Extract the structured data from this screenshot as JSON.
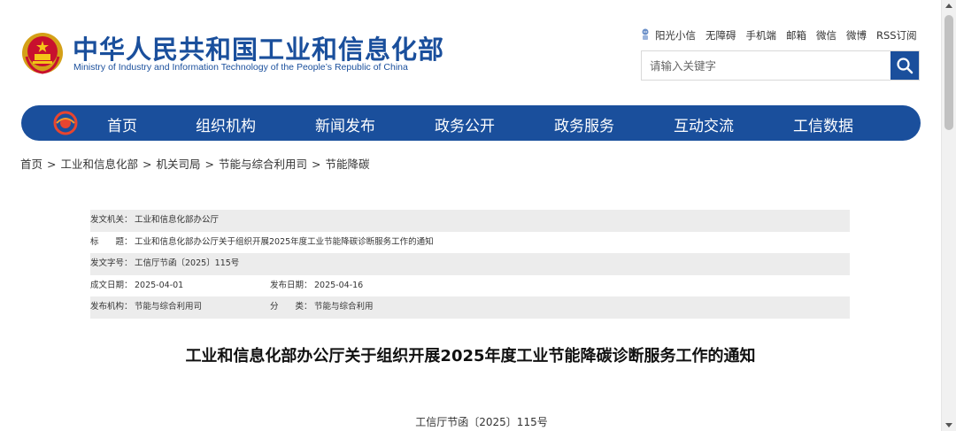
{
  "header": {
    "title": "中华人民共和国工业和信息化部",
    "subtitle": "Ministry of Industry and Information Technology of the People’s Republic of China",
    "toplinks": [
      "阳光小信",
      "无障碍",
      "手机端",
      "邮箱",
      "微信",
      "微博",
      "RSS订阅"
    ],
    "search_placeholder": "请输入关键字"
  },
  "nav": {
    "items": [
      "首页",
      "组织机构",
      "新闻发布",
      "政务公开",
      "政务服务",
      "互动交流",
      "工信数据"
    ]
  },
  "breadcrumb": [
    "首页",
    "工业和信息化部",
    "机关司局",
    "节能与综合利用司",
    "节能降碳"
  ],
  "meta": {
    "issuer_label": "发文机关：",
    "issuer": "工业和信息化部办公厅",
    "title_label": "标　　题：",
    "title": "工业和信息化部办公厅关于组织开展2025年度工业节能降碳诊断服务工作的通知",
    "docno_label": "发文字号：",
    "docno": "工信厅节函〔2025〕115号",
    "created_label": "成文日期：",
    "created": "2025-04-01",
    "published_label": "发布日期：",
    "published": "2025-04-16",
    "agency_label": "发布机构：",
    "agency": "节能与综合利用司",
    "category_label": "分　　类：",
    "category": "节能与综合利用"
  },
  "document": {
    "title": "工业和信息化部办公厅关于组织开展2025年度工业节能降碳诊断服务工作的通知",
    "number": "工信厅节函〔2025〕115号"
  },
  "colors": {
    "brand_blue": "#1a4f9c",
    "meta_shade": "#ececec"
  }
}
